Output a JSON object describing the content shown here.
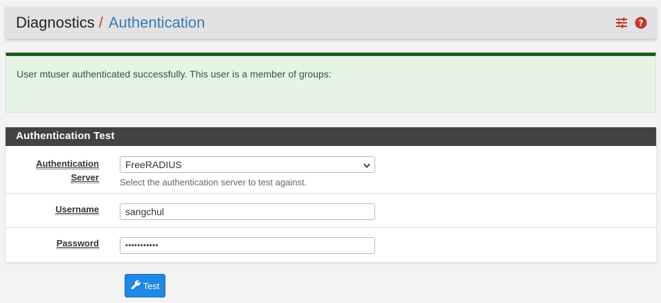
{
  "breadcrumb": {
    "root": "Diagnostics",
    "separator": "/",
    "current": "Authentication"
  },
  "header_icons": [
    "sliders-icon",
    "help-icon"
  ],
  "alert": {
    "message": "User mtuser authenticated successfully. This user is a member of groups:"
  },
  "panel": {
    "title": "Authentication Test",
    "server": {
      "label_line1": "Authentication",
      "label_line2": "Server",
      "selected": "FreeRADIUS",
      "help": "Select the authentication server to test against."
    },
    "username": {
      "label": "Username",
      "value": "sangchul"
    },
    "password": {
      "label": "Password",
      "masked_value": "•••••••••••"
    }
  },
  "test_button": {
    "label": "Test"
  },
  "colors": {
    "header_bg": "#e2e2e2",
    "accent_red": "#c0392b",
    "crumb_blue": "#3a7ab5",
    "alert_bg": "#e6f4e6",
    "alert_border": "#1e5c1e",
    "panel_heading_bg": "#424242",
    "button_blue": "#1e88e5"
  }
}
